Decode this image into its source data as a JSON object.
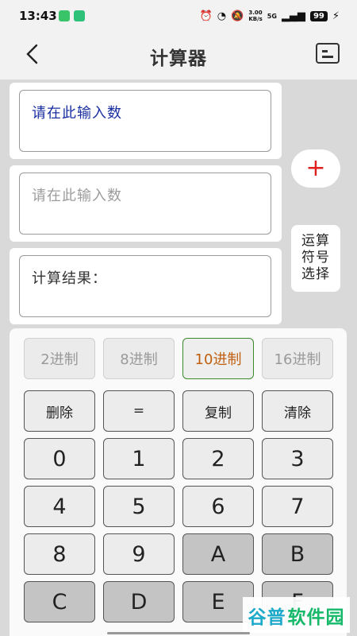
{
  "status": {
    "time": "13:43",
    "net_speed_value": "3.00",
    "net_speed_unit": "KB/s",
    "signal": "5G",
    "battery": "99"
  },
  "header": {
    "title": "计算器",
    "back_icon": "chevron-left-icon",
    "history_icon": "history-list-icon"
  },
  "inputs": {
    "first_value": "请在此输入数",
    "second_placeholder": "请在此输入数",
    "result_label": "计算结果："
  },
  "side": {
    "operator_symbol": "+",
    "operator_select_lines": [
      "运算",
      "符号",
      "选择"
    ]
  },
  "bases": [
    {
      "label": "2进制",
      "active": false
    },
    {
      "label": "8进制",
      "active": false
    },
    {
      "label": "10进制",
      "active": true
    },
    {
      "label": "16进制",
      "active": false
    }
  ],
  "functions": [
    "删除",
    "=",
    "复制",
    "清除"
  ],
  "keys": [
    "0",
    "1",
    "2",
    "3",
    "4",
    "5",
    "6",
    "7",
    "8",
    "9",
    "A",
    "B",
    "C",
    "D",
    "E",
    "F"
  ],
  "watermark": {
    "part1": "谷普",
    "part2": "软件园"
  },
  "colors": {
    "accent_result": "#1a2fa0",
    "active_base_text": "#c05f0e",
    "active_base_border": "#3a8a2a",
    "plus": "#e01f1f"
  }
}
